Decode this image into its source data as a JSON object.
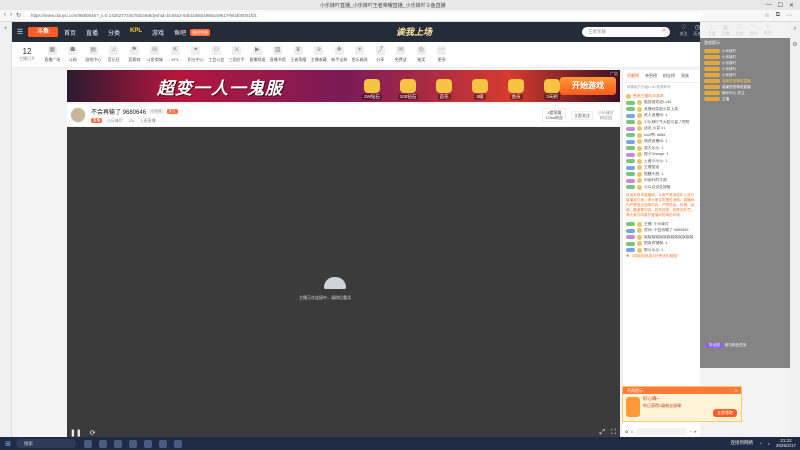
{
  "browser": {
    "title": "小乐妹吖直播_小乐妹吖王者荣耀直播_小乐妹吖斗鱼直播",
    "url": "https://www.douyu.com/9680646?_t=0.14262774457652468dyshid=bc58a2-84b1bb6b4985a49617#ebd00001f01"
  },
  "header": {
    "menu_icon": "☰",
    "logo": "斗鱼",
    "nav": [
      "首页",
      "直播",
      "分类",
      "KPL",
      "游戏",
      "鱼吧"
    ],
    "kpl_item": "KPL",
    "promo": "限时特权",
    "slogan": "诶我上场",
    "search_placeholder": "王者荣耀",
    "right_items": [
      "关注",
      "历史",
      "下载",
      "开播",
      "任务",
      "我的",
      "签到"
    ]
  },
  "categories": {
    "follow_count": "12",
    "follow_label": "主播已开",
    "items": [
      "直播广场",
      "斗粉",
      "游戏中心",
      "音乐狂",
      "竞赛城",
      "斗鱼商城",
      "KPL",
      "积分中心",
      "工会公会",
      "三国在手",
      "直播频道",
      "直播书馆",
      "王者荣耀",
      "主播收藏",
      "新手宝典",
      "鱼乐精选",
      "分享",
      "免费送",
      "抽奖",
      "更多"
    ]
  },
  "banner": {
    "title": "超变一人一鬼服",
    "items": [
      "2W钻石",
      "100钻石",
      "首充",
      "5级",
      "会员",
      "3天刷"
    ],
    "cta": "开始游戏",
    "ad_label": "广告"
  },
  "room": {
    "title": "不会再输了 9680646",
    "tag_gray": "小乐妹",
    "tag_orange": "关注",
    "sub": [
      "直播",
      "小乐妹吖",
      "12k",
      "上麦直播"
    ],
    "fans_box": "1楼荣耀\n125w粉丝",
    "follow_box": "立即关注",
    "fans_group": "小乐妹吖\n粉丝团"
  },
  "video": {
    "loading_text": "主播正在连接中，请稍后重试",
    "ctrl_left": [
      "❚❚",
      "⟳"
    ],
    "ctrl_right": [
      "⤢",
      "⛶"
    ]
  },
  "chat": {
    "tabs": [
      "贡献榜",
      "亲密榜",
      "粉丝榜",
      "贵族"
    ],
    "banner": "恭喜用户升级Lv30 获得称号",
    "messages": [
      {
        "t": "感谢主播的冰淇淋",
        "k": "sys"
      },
      {
        "t": "酷我很欢迎Lv30",
        "k": "lv"
      },
      {
        "t": "直播间奖励火箭上架",
        "k": "lv"
      },
      {
        "t": "进入直播间: 1",
        "k": "b"
      },
      {
        "t": "小乐妹吖今天超可爱了哈哈",
        "k": "lv"
      },
      {
        "t": "送出 火箭 x1",
        "k": "p"
      },
      {
        "t": "cool鸭: 6666",
        "k": "lv"
      },
      {
        "t": "刚进直播间: 1",
        "k": "b"
      },
      {
        "t": "我大乐乐: 1",
        "k": "lv"
      },
      {
        "t": "橙子Orange: 1",
        "k": "p"
      },
      {
        "t": "王者小乐乐: 1",
        "k": "lv"
      },
      {
        "t": "主播加油",
        "k": "b"
      },
      {
        "t": "橙糖不甜: 1",
        "k": "lv"
      },
      {
        "t": "阿丽叶的大鹅",
        "k": "p"
      },
      {
        "t": "可以试试金刚盾",
        "k": "lv"
      }
    ],
    "notice": "欢迎来到本直播间，斗鱼严禁未成年人进行直播或打赏，请大家注意理性消费。直播间内严禁违法违规内容，严禁低俗、色情、吸烟、酗酒等内容。若有违规，将受到处罚，请大家共同维护直播间的绿色环境。",
    "messages2": [
      {
        "t": "主播: 小乐妹吖",
        "k": "lv"
      },
      {
        "t": "房间: 不会再输了 9680646",
        "k": "b"
      },
      {
        "t": "娱娱娱娱娱娱娱娱娱娱娱娱娱",
        "k": "p"
      },
      {
        "t": "炮哥的钢钢: 1",
        "k": "lv"
      },
      {
        "t": "郭可乐乐: 1",
        "k": "b"
      }
    ],
    "footer_note": "1等级加成第3分钟送礼翻倍！",
    "bottom": [
      "✿",
      "☺",
      "◔",
      "➤"
    ]
  },
  "gift_popup": {
    "head": "不再提示",
    "title": "好心确~",
    "sub": "你已获得1级粉丝勋章",
    "btn": "立即领取"
  },
  "overlay": {
    "head": "游戏提示",
    "lines": [
      {
        "t": "小乐妹吖",
        "y": false
      },
      {
        "t": "小乐妹吖",
        "y": false
      },
      {
        "t": "小乐妹吖",
        "y": false
      },
      {
        "t": "小乐妹吖",
        "y": false
      },
      {
        "t": "小乐妹吖",
        "y": false
      },
      {
        "t": "感谢您的精彩直播",
        "y": true
      },
      {
        "t": "感谢您的精彩直播",
        "y": false
      },
      {
        "t": "娱乐中心 关注",
        "y": false
      },
      {
        "t": "主播",
        "y": false
      }
    ],
    "bottom_pill": "粉丝团",
    "bottom_text": "参与粉丝任务"
  },
  "taskbar": {
    "search": "搜索",
    "tray_text": "连接到网络",
    "time": "21:22",
    "date": "2025/2/17"
  }
}
